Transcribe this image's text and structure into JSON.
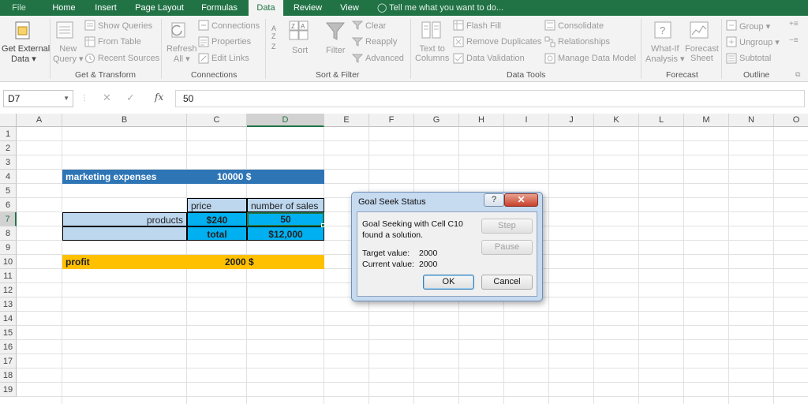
{
  "tabs": [
    "File",
    "Home",
    "Insert",
    "Page Layout",
    "Formulas",
    "Data",
    "Review",
    "View"
  ],
  "tell_me": "Tell me what you want to do...",
  "ribbon": {
    "get_external": {
      "line1": "Get External",
      "line2": "Data ▾"
    },
    "new_query": {
      "line1": "New",
      "line2": "Query ▾"
    },
    "show_queries": "Show Queries",
    "from_table": "From Table",
    "recent_sources": "Recent Sources",
    "refresh_all": {
      "line1": "Refresh",
      "line2": "All ▾"
    },
    "connections": "Connections",
    "properties": "Properties",
    "edit_links": "Edit Links",
    "sort": "Sort",
    "filter": "Filter",
    "clear": "Clear",
    "reapply": "Reapply",
    "advanced": "Advanced",
    "text_to_columns": {
      "line1": "Text to",
      "line2": "Columns"
    },
    "flash_fill": "Flash Fill",
    "remove_duplicates": "Remove Duplicates",
    "data_validation": "Data Validation",
    "consolidate": "Consolidate",
    "relationships": "Relationships",
    "manage_data_model": "Manage Data Model",
    "what_if": {
      "line1": "What-If",
      "line2": "Analysis ▾"
    },
    "forecast_sheet": {
      "line1": "Forecast",
      "line2": "Sheet"
    },
    "group": "Group ▾",
    "ungroup": "Ungroup ▾",
    "subtotal": "Subtotal",
    "groups": {
      "get_transform": "Get & Transform",
      "connections": "Connections",
      "sort_filter": "Sort & Filter",
      "data_tools": "Data Tools",
      "forecast": "Forecast",
      "outline": "Outline"
    }
  },
  "formula_bar": {
    "name_box": "D7",
    "fx": "fx",
    "value": "50"
  },
  "columns": [
    "A",
    "B",
    "C",
    "D",
    "E",
    "F",
    "G",
    "H",
    "I",
    "J",
    "K",
    "L",
    "M",
    "N",
    "O"
  ],
  "rows": [
    "1",
    "2",
    "3",
    "4",
    "5",
    "6",
    "7",
    "8",
    "9",
    "10",
    "11",
    "12",
    "13",
    "14",
    "15",
    "16",
    "17",
    "18",
    "19"
  ],
  "cells": {
    "B4": "marketing expenses",
    "C4": "10000 $",
    "C6": "price",
    "D6": "number of sales",
    "B7": "products",
    "C7": "$240",
    "D7": "50",
    "C8": "total",
    "D8": "$12,000",
    "B10": "profit",
    "C10": "2000 $"
  },
  "colors": {
    "accent": "#217346",
    "blue_header": "#2e75b6",
    "teal_cell": "#00b0f0",
    "light_blue": "#bdd7ee",
    "orange": "#ffc000"
  },
  "dialog": {
    "title": "Goal Seek Status",
    "help": "?",
    "close": "✕",
    "message_line1": "Goal Seeking with Cell C10",
    "message_line2": "found a solution.",
    "target_label": "Target value:",
    "target_value": "2000",
    "current_label": "Current value:",
    "current_value": "2000",
    "step": "Step",
    "pause": "Pause",
    "ok": "OK",
    "cancel": "Cancel"
  }
}
